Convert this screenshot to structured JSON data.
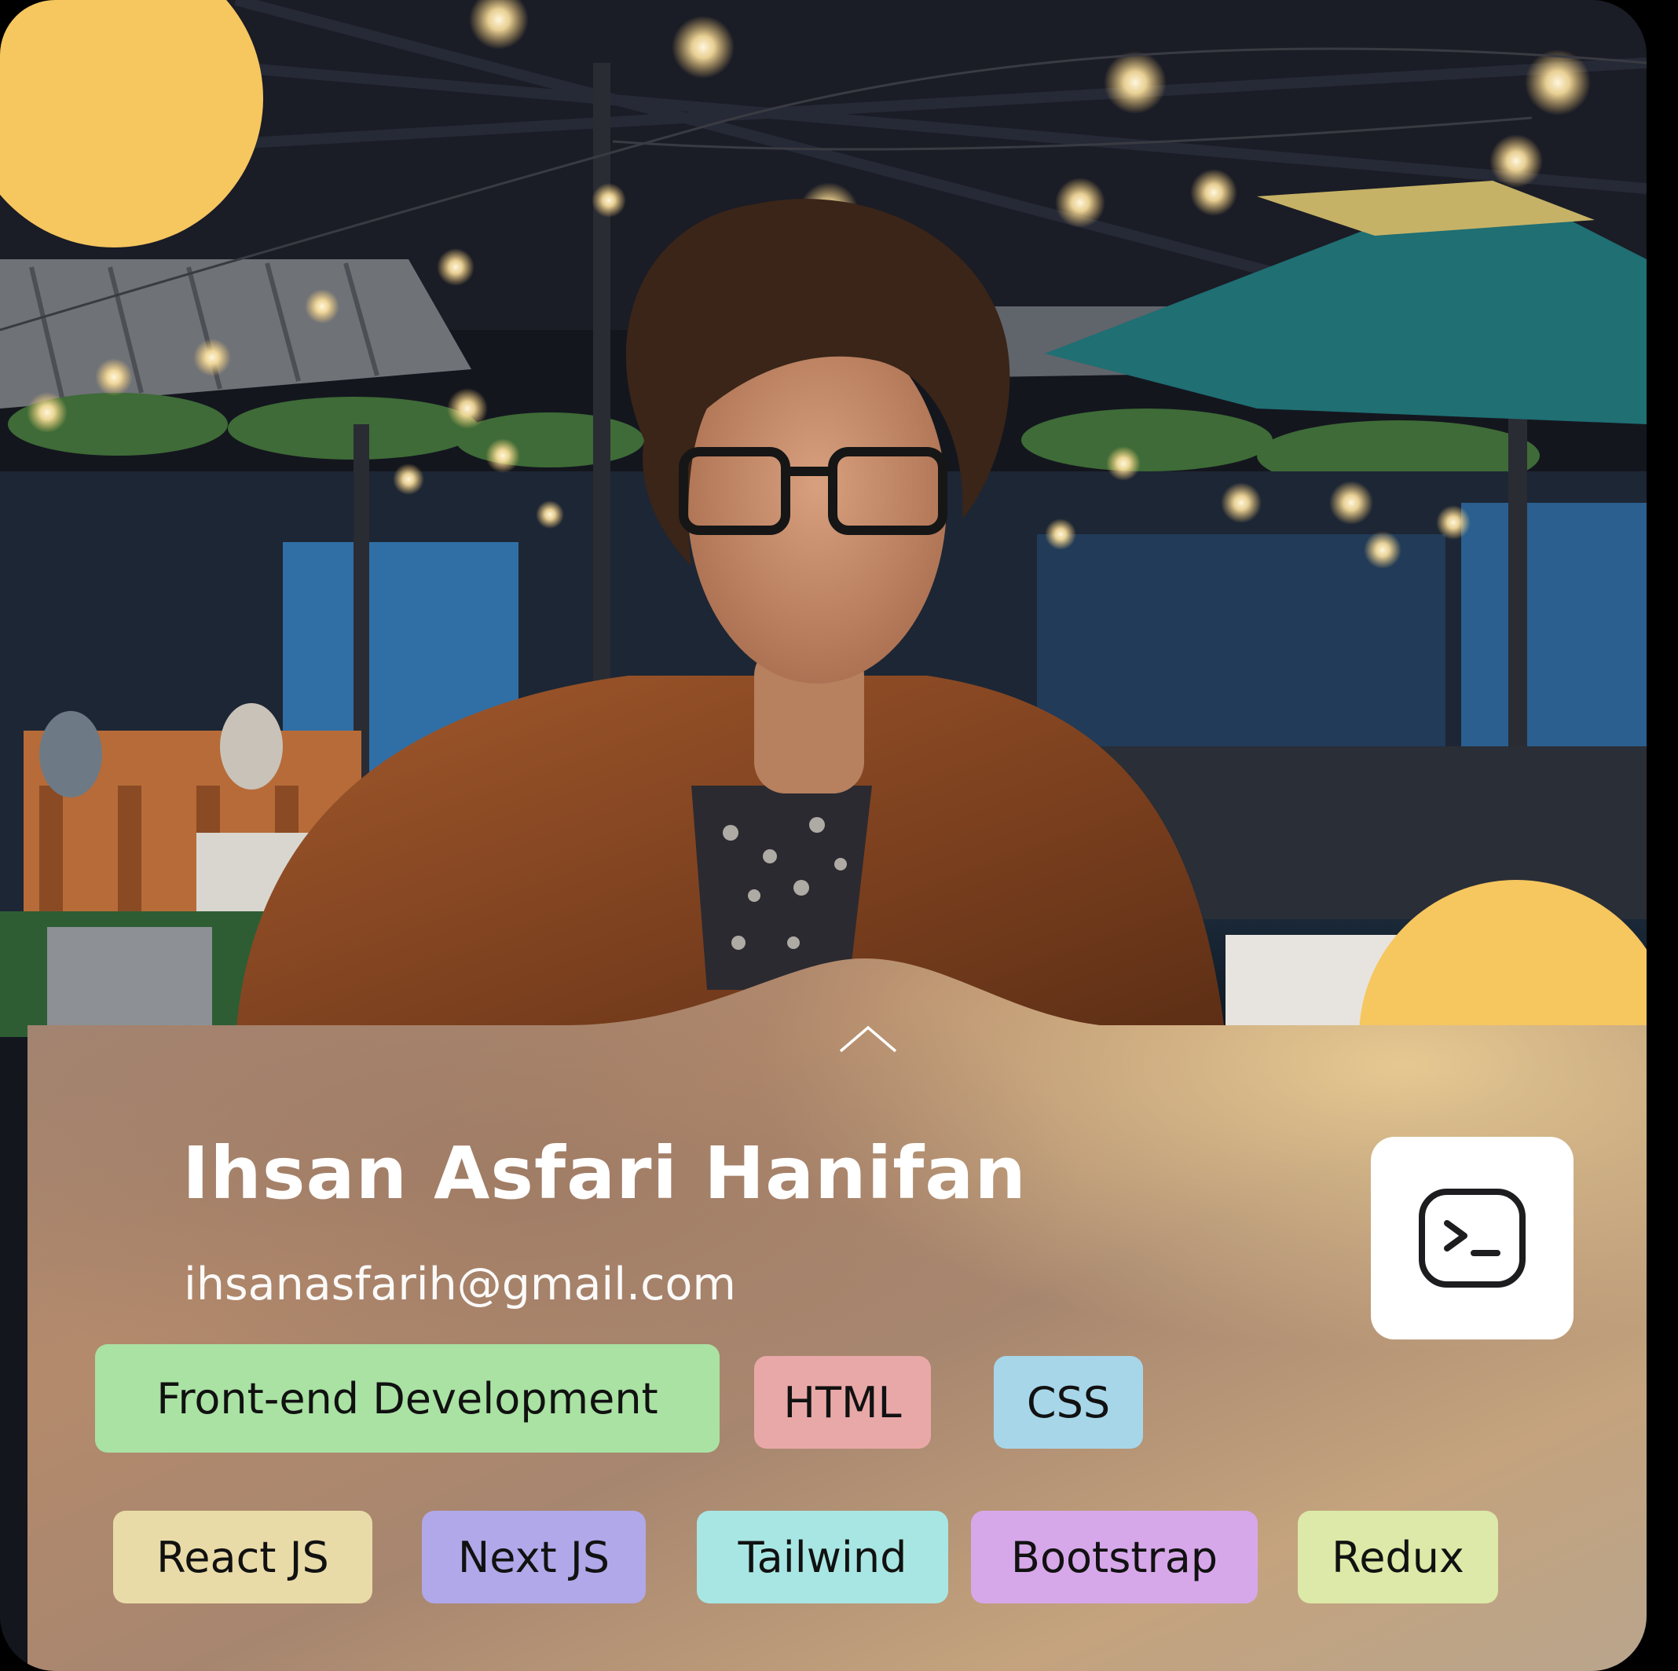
{
  "profile": {
    "name": "Ihsan Asfari Hanifan",
    "email": "ihsanasfarih@gmail.com"
  },
  "icons": {
    "expand": "chevron-up-icon",
    "terminal": "terminal-icon"
  },
  "tags": [
    {
      "label": "Front-end Development",
      "color": "#a9e2a3"
    },
    {
      "label": "HTML",
      "color": "#e9a8a8"
    },
    {
      "label": "CSS",
      "color": "#a7d6e9"
    },
    {
      "label": "React JS",
      "color": "#e9dba8"
    },
    {
      "label": "Next JS",
      "color": "#b1a8e9"
    },
    {
      "label": "Tailwind",
      "color": "#a8e6e3"
    },
    {
      "label": "Bootstrap",
      "color": "#d6a8e9"
    },
    {
      "label": "Redux",
      "color": "#dce9a8"
    }
  ],
  "colors": {
    "accent_circle": "#f6c65f",
    "panel_tint": "#b99276"
  }
}
